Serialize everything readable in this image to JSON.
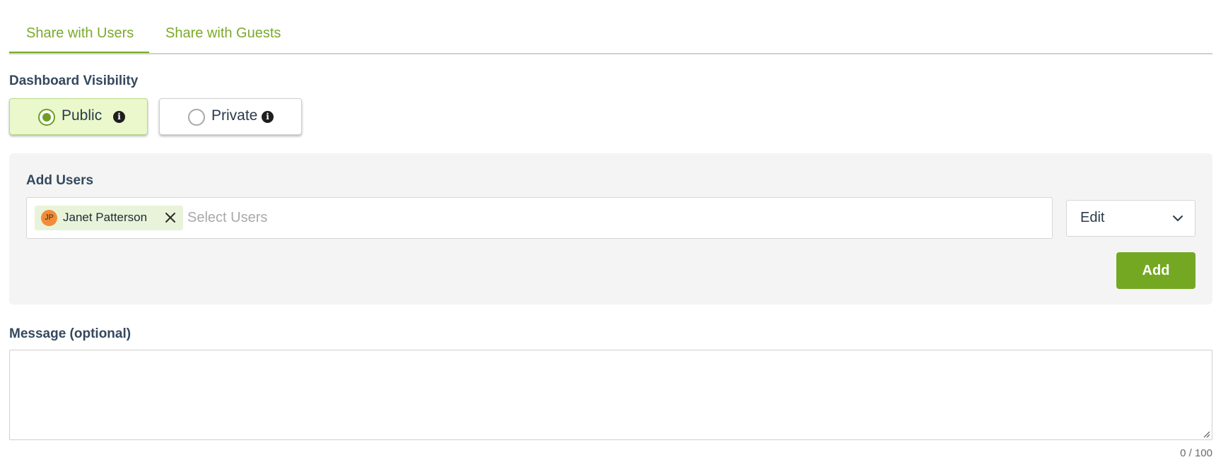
{
  "tabs": [
    {
      "label": "Share with Users",
      "active": true
    },
    {
      "label": "Share with Guests",
      "active": false
    }
  ],
  "visibility": {
    "title": "Dashboard Visibility",
    "options": [
      {
        "label": "Public",
        "selected": true,
        "icon": "info-icon"
      },
      {
        "label": "Private",
        "selected": false,
        "icon": "info-icon"
      }
    ]
  },
  "add_users": {
    "title": "Add Users",
    "selected_users": [
      {
        "initials": "JP",
        "name": "Janet Patterson",
        "avatar_color": "#f28c3a"
      }
    ],
    "placeholder": "Select Users",
    "role": "Edit",
    "add_label": "Add"
  },
  "message": {
    "label": "Message (optional)",
    "value": "",
    "counter": "0 / 100"
  },
  "colors": {
    "accent": "#7aaa2a",
    "button": "#74a823",
    "selected_bg": "#eaf8cc",
    "panel_bg": "#f4f4f4"
  }
}
